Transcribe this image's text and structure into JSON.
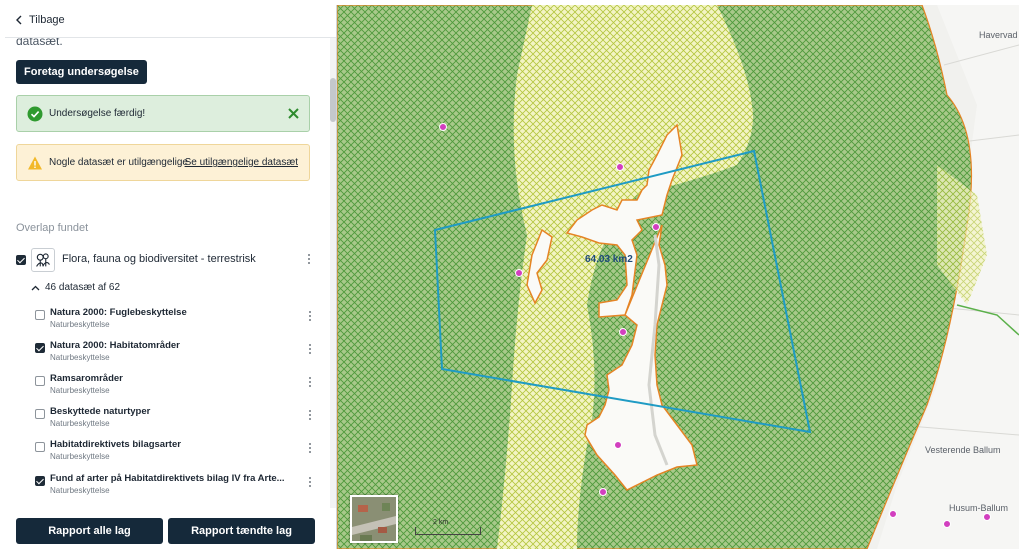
{
  "panel": {
    "back_label": "Tilbage",
    "intro_cut_text": "datasæt.",
    "run_button": "Foretag undersøgelse",
    "success_text": "Undersøgelse færdig!",
    "warning_text": "Nogle datasæt er utilgængelige",
    "warning_link": "Se utilgængelige datasæt",
    "overlap_title": "Overlap fundet",
    "group": {
      "label": "Flora, fauna og biodiversitet - terrestrisk",
      "checked": true,
      "count_label": "46 datasæt af 62"
    },
    "datasets": [
      {
        "title": "Natura 2000: Fuglebeskyttelse",
        "subtitle": "Naturbeskyttelse",
        "checked": false
      },
      {
        "title": "Natura 2000: Habitatområder",
        "subtitle": "Naturbeskyttelse",
        "checked": true
      },
      {
        "title": "Ramsarområder",
        "subtitle": "Naturbeskyttelse",
        "checked": false
      },
      {
        "title": "Beskyttede naturtyper",
        "subtitle": "Naturbeskyttelse",
        "checked": false
      },
      {
        "title": "Habitatdirektivets bilagsarter",
        "subtitle": "Naturbeskyttelse",
        "checked": false
      },
      {
        "title": "Fund af arter på Habitatdirektivets bilag IV fra Arte...",
        "subtitle": "Naturbeskyttelse",
        "checked": true
      }
    ],
    "report_all": "Rapport alle lag",
    "report_lit": "Rapport tændte lag"
  },
  "map": {
    "area_label": "64.03 km2",
    "scale_label": "2 km",
    "places": [
      "Havervad",
      "Vesterende Ballum",
      "Husum-Ballum"
    ]
  },
  "colors": {
    "primary_button": "#15293a",
    "success_bg": "#ddeedd",
    "warning_bg": "#fdf1d6",
    "hatch_green": "#4f9a3c",
    "hatch_lime": "#b4c63f",
    "area_outline": "#e58425",
    "polygon_stroke": "#1f9bc4",
    "point_marker": "#d23fbf"
  }
}
